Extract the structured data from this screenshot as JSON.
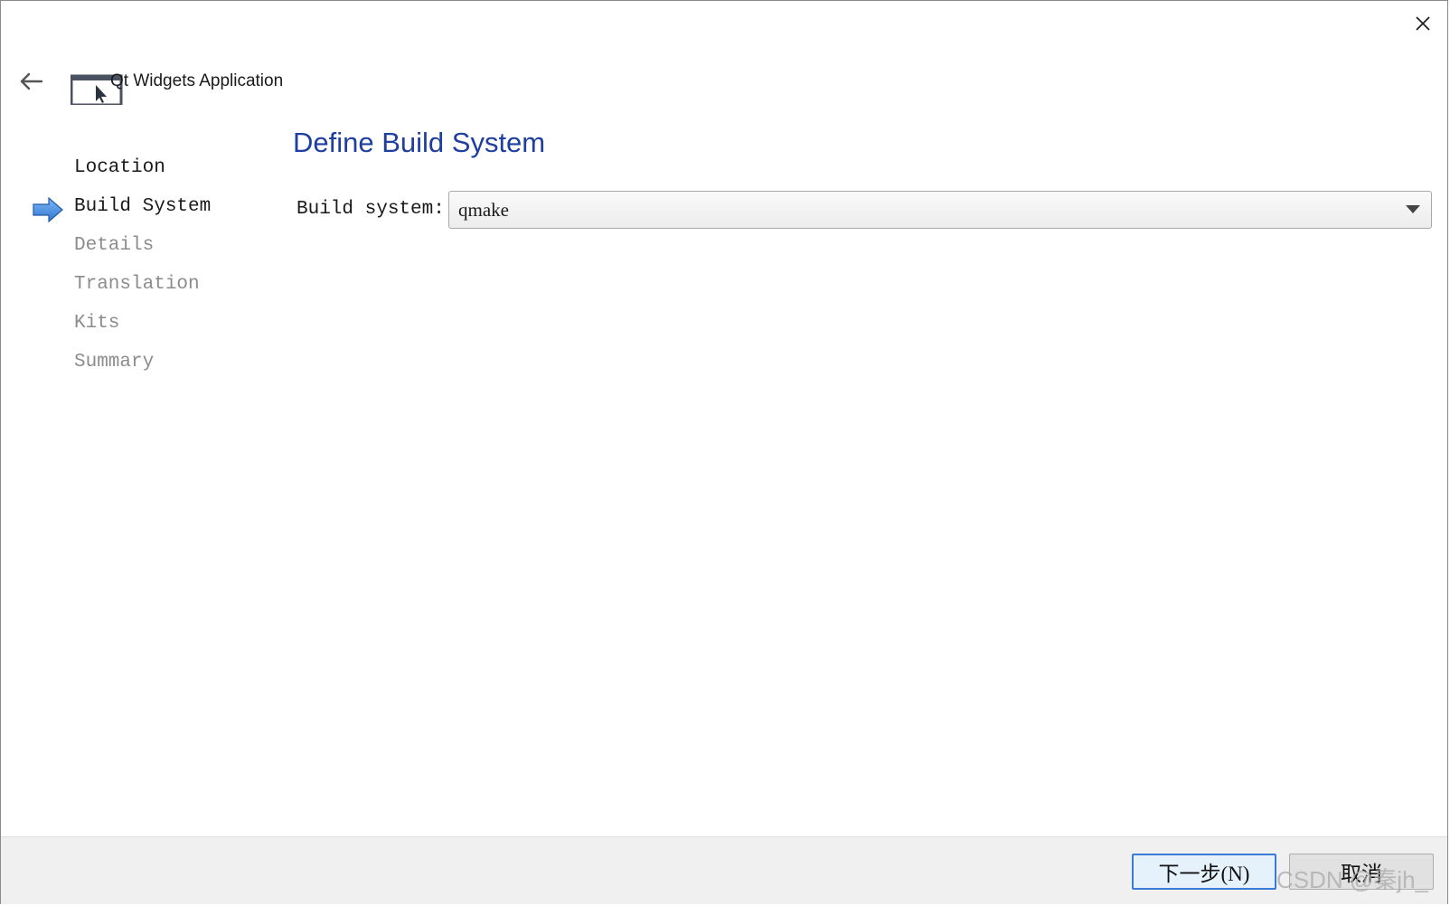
{
  "header": {
    "app_title": "Qt Widgets Application"
  },
  "wizard": {
    "steps": [
      {
        "label": "Location",
        "state": "done"
      },
      {
        "label": "Build System",
        "state": "current"
      },
      {
        "label": "Details",
        "state": "pending"
      },
      {
        "label": "Translation",
        "state": "pending"
      },
      {
        "label": "Kits",
        "state": "pending"
      },
      {
        "label": "Summary",
        "state": "pending"
      }
    ]
  },
  "page": {
    "title": "Define Build System",
    "build_system_label": "Build system:",
    "build_system_value": "qmake"
  },
  "footer": {
    "next_label": "下一步(N)",
    "cancel_label": "取消"
  },
  "watermark": "CSDN @秦jh_",
  "colors": {
    "title_blue": "#1e3fa0",
    "arrow_blue": "#3a86e0",
    "pending_gray": "#8c8c8c"
  },
  "icons": {
    "close": "close-icon",
    "back": "back-arrow-icon",
    "app": "application-window-icon",
    "step_marker": "current-step-arrow-icon",
    "dropdown": "chevron-down-icon"
  }
}
